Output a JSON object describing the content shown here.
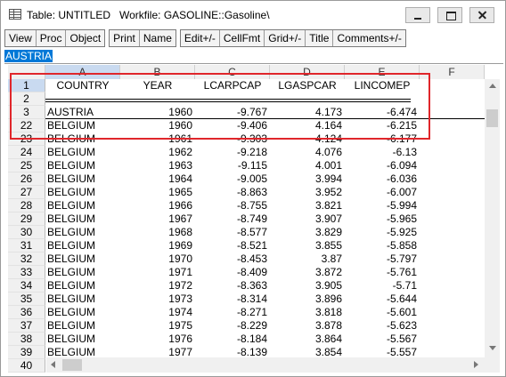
{
  "window": {
    "title": "Table: UNTITLED   Workfile: GASOLINE::Gasoline\\"
  },
  "toolbar": {
    "groups": [
      [
        "View",
        "Proc",
        "Object"
      ],
      [
        "Print",
        "Name"
      ],
      [
        "Edit+/-",
        "CellFmt",
        "Grid+/-",
        "Title",
        "Comments+/-"
      ]
    ]
  },
  "edit_line": {
    "value": "AUSTRIA"
  },
  "grid": {
    "column_headers": [
      "A",
      "B",
      "C",
      "D",
      "E",
      "F"
    ],
    "selected_column": "A",
    "selected_row": "1",
    "rows": [
      {
        "num": "1",
        "cells": [
          "COUNTRY",
          "YEAR",
          "LCARPCAP",
          "LGASPCAR",
          "LINCOMEP"
        ]
      },
      {
        "num": "2",
        "cells": [
          "",
          "",
          "",
          "",
          ""
        ]
      },
      {
        "num": "3",
        "cells": [
          "AUSTRIA",
          "1960",
          "-9.767",
          "4.173",
          "-6.474"
        ]
      },
      {
        "num": "22",
        "cells": [
          "BELGIUM",
          "1960",
          "-9.406",
          "4.164",
          "-6.215"
        ]
      },
      {
        "num": "23",
        "cells": [
          "BELGIUM",
          "1961",
          "-9.303",
          "4.124",
          "-6.177"
        ]
      },
      {
        "num": "24",
        "cells": [
          "BELGIUM",
          "1962",
          "-9.218",
          "4.076",
          "-6.13"
        ]
      },
      {
        "num": "25",
        "cells": [
          "BELGIUM",
          "1963",
          "-9.115",
          "4.001",
          "-6.094"
        ]
      },
      {
        "num": "26",
        "cells": [
          "BELGIUM",
          "1964",
          "-9.005",
          "3.994",
          "-6.036"
        ]
      },
      {
        "num": "27",
        "cells": [
          "BELGIUM",
          "1965",
          "-8.863",
          "3.952",
          "-6.007"
        ]
      },
      {
        "num": "28",
        "cells": [
          "BELGIUM",
          "1966",
          "-8.755",
          "3.821",
          "-5.994"
        ]
      },
      {
        "num": "29",
        "cells": [
          "BELGIUM",
          "1967",
          "-8.749",
          "3.907",
          "-5.965"
        ]
      },
      {
        "num": "30",
        "cells": [
          "BELGIUM",
          "1968",
          "-8.577",
          "3.829",
          "-5.925"
        ]
      },
      {
        "num": "31",
        "cells": [
          "BELGIUM",
          "1969",
          "-8.521",
          "3.855",
          "-5.858"
        ]
      },
      {
        "num": "32",
        "cells": [
          "BELGIUM",
          "1970",
          "-8.453",
          "3.87",
          "-5.797"
        ]
      },
      {
        "num": "33",
        "cells": [
          "BELGIUM",
          "1971",
          "-8.409",
          "3.872",
          "-5.761"
        ]
      },
      {
        "num": "34",
        "cells": [
          "BELGIUM",
          "1972",
          "-8.363",
          "3.905",
          "-5.71"
        ]
      },
      {
        "num": "35",
        "cells": [
          "BELGIUM",
          "1973",
          "-8.314",
          "3.896",
          "-5.644"
        ]
      },
      {
        "num": "36",
        "cells": [
          "BELGIUM",
          "1974",
          "-8.271",
          "3.818",
          "-5.601"
        ]
      },
      {
        "num": "37",
        "cells": [
          "BELGIUM",
          "1975",
          "-8.229",
          "3.878",
          "-5.623"
        ]
      },
      {
        "num": "38",
        "cells": [
          "BELGIUM",
          "1976",
          "-8.184",
          "3.864",
          "-5.567"
        ]
      },
      {
        "num": "39",
        "cells": [
          "BELGIUM",
          "1977",
          "-8.139",
          "3.854",
          "-5.557"
        ]
      },
      {
        "num": "40",
        "cells": [
          "",
          "",
          "",
          "",
          ""
        ]
      }
    ]
  },
  "colors": {
    "selection": "#0078d7",
    "header_selected": "#c9daf0",
    "annotation_box": "#e0262b"
  }
}
